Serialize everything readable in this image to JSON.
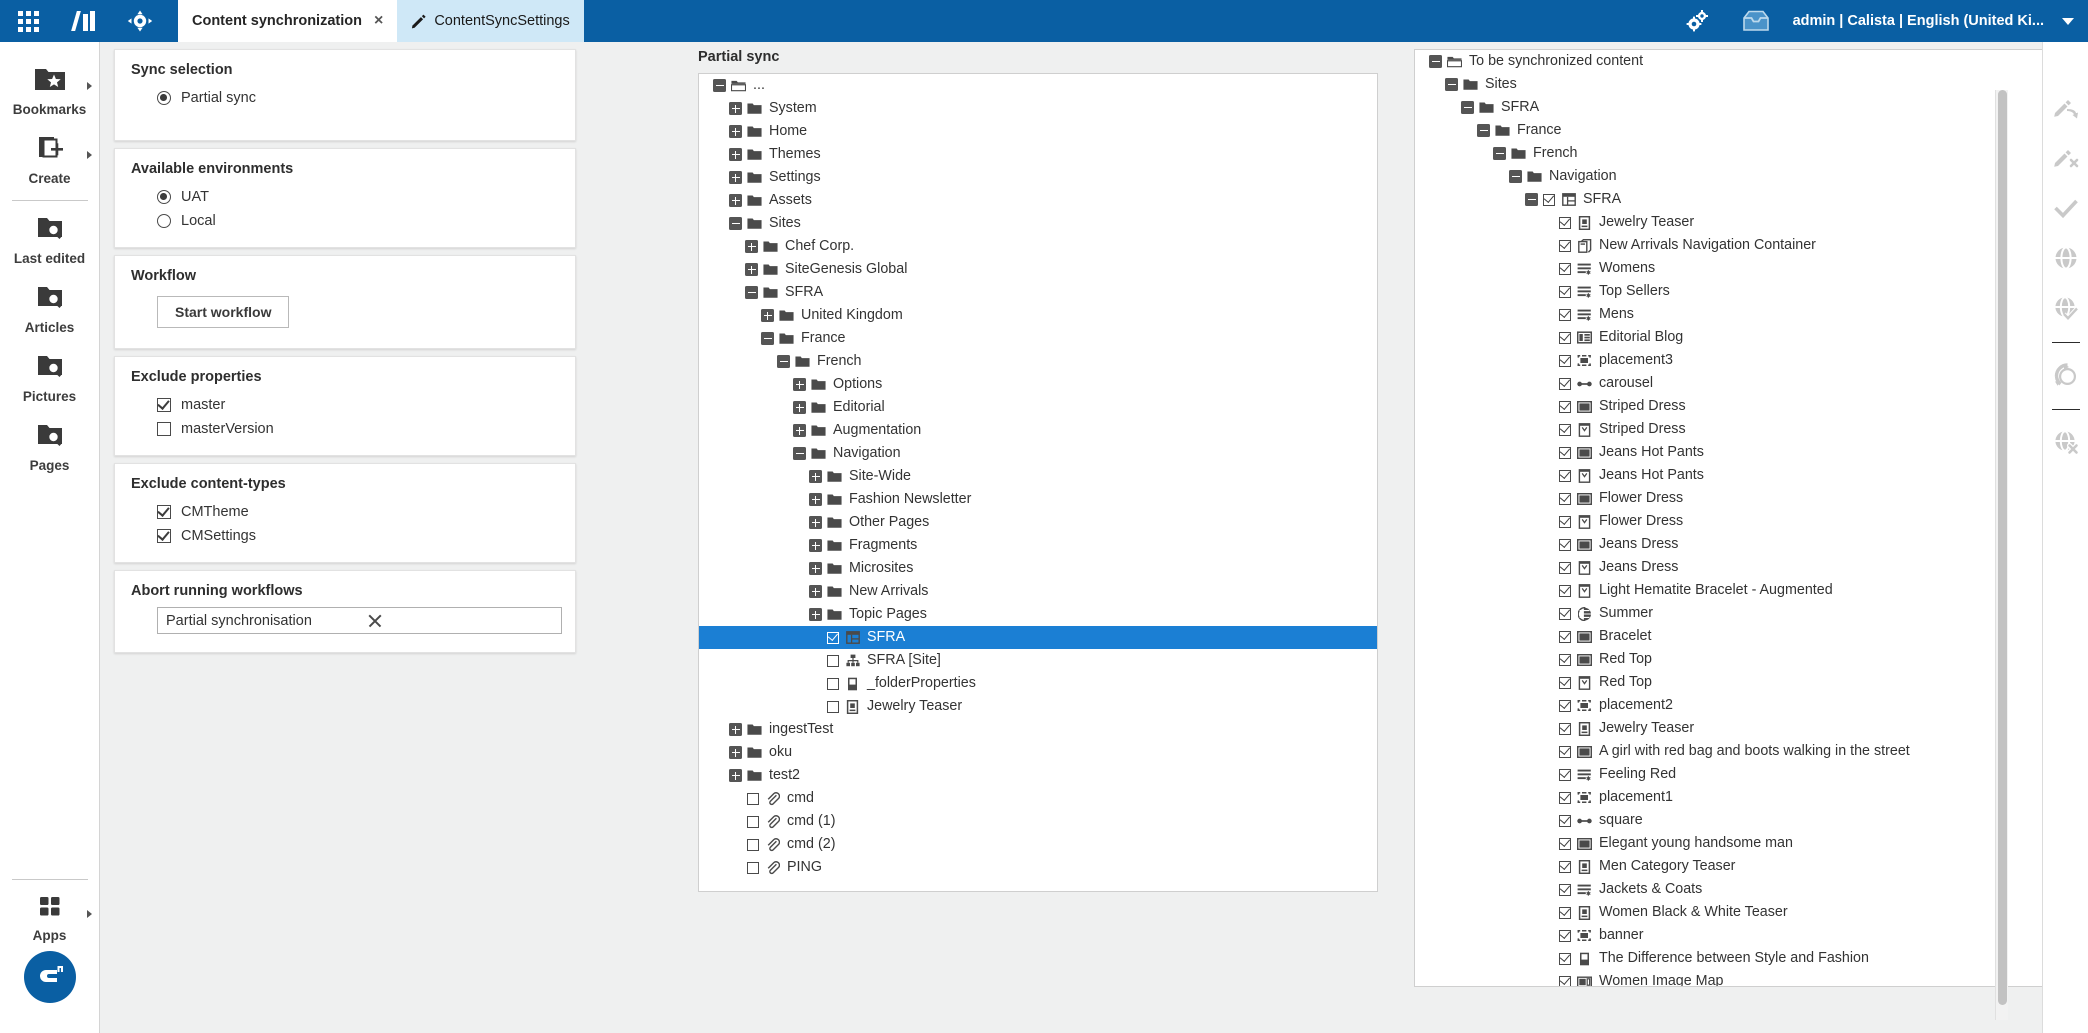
{
  "topbar": {
    "apps_grid_icon": "apps-grid-icon",
    "logo_icon": "coremedia-logo-icon",
    "compass_icon": "compass-icon",
    "tabs": [
      {
        "label": "Content synchronization",
        "active": true,
        "closable": true,
        "close_label": "×"
      },
      {
        "label": "ContentSyncSettings",
        "active": false,
        "icon": "pencil-icon"
      }
    ],
    "gears_icon": "gears-icon",
    "inbox_icon": "inbox-icon",
    "user": "admin | Calista | English (United Ki...",
    "caret_icon": "chevron-down-icon"
  },
  "leftrail": {
    "items": [
      {
        "label": "Bookmarks",
        "icon": "folder-star-icon",
        "arrow": true
      },
      {
        "label": "Create",
        "icon": "create-doc-icon",
        "arrow": true
      },
      {
        "label": "Last edited",
        "icon": "folder-search-icon",
        "arrow": false
      },
      {
        "label": "Articles",
        "icon": "folder-search-icon",
        "arrow": false
      },
      {
        "label": "Pictures",
        "icon": "folder-search-icon",
        "arrow": false
      },
      {
        "label": "Pages",
        "icon": "folder-search-icon",
        "arrow": false
      }
    ],
    "apps": {
      "label": "Apps",
      "icon": "apps-squares-icon",
      "arrow": true
    },
    "badge_icon": "coremedia-badge-icon"
  },
  "form": {
    "sync_selection": {
      "title": "Sync selection",
      "options": [
        {
          "label": "Partial sync",
          "checked": true
        }
      ]
    },
    "available_environments": {
      "title": "Available environments",
      "options": [
        {
          "label": "UAT",
          "checked": true
        },
        {
          "label": "Local",
          "checked": false
        }
      ]
    },
    "workflow": {
      "title": "Workflow",
      "button_label": "Start workflow"
    },
    "exclude_properties": {
      "title": "Exclude properties",
      "options": [
        {
          "label": "master",
          "checked": true
        },
        {
          "label": "masterVersion",
          "checked": false
        }
      ]
    },
    "exclude_content_types": {
      "title": "Exclude content-types",
      "options": [
        {
          "label": "CMTheme",
          "checked": true
        },
        {
          "label": "CMSettings",
          "checked": true
        }
      ]
    },
    "abort_running_workflows": {
      "title": "Abort running workflows",
      "value": "Partial synchronisation",
      "placeholder": "",
      "clear_icon": "clear-x-icon"
    }
  },
  "mid_panel": {
    "label": "Partial sync",
    "nodes": [
      {
        "depth": 0,
        "toggle": "minus",
        "icon": "folder-open-icon",
        "label": "..."
      },
      {
        "depth": 1,
        "toggle": "plus",
        "icon": "folder-icon",
        "label": "System"
      },
      {
        "depth": 1,
        "toggle": "plus",
        "icon": "folder-icon",
        "label": "Home"
      },
      {
        "depth": 1,
        "toggle": "plus",
        "icon": "folder-icon",
        "label": "Themes"
      },
      {
        "depth": 1,
        "toggle": "plus",
        "icon": "folder-icon",
        "label": "Settings"
      },
      {
        "depth": 1,
        "toggle": "plus",
        "icon": "folder-icon",
        "label": "Assets"
      },
      {
        "depth": 1,
        "toggle": "minus",
        "icon": "folder-icon",
        "label": "Sites"
      },
      {
        "depth": 2,
        "toggle": "plus",
        "icon": "folder-icon",
        "label": "Chef Corp."
      },
      {
        "depth": 2,
        "toggle": "plus",
        "icon": "folder-icon",
        "label": "SiteGenesis Global"
      },
      {
        "depth": 2,
        "toggle": "minus",
        "icon": "folder-icon",
        "label": "SFRA"
      },
      {
        "depth": 3,
        "toggle": "plus",
        "icon": "folder-icon",
        "label": "United Kingdom"
      },
      {
        "depth": 3,
        "toggle": "minus",
        "icon": "folder-icon",
        "label": "France"
      },
      {
        "depth": 4,
        "toggle": "minus",
        "icon": "folder-icon",
        "label": "French"
      },
      {
        "depth": 5,
        "toggle": "plus",
        "icon": "folder-icon",
        "label": "Options"
      },
      {
        "depth": 5,
        "toggle": "plus",
        "icon": "folder-icon",
        "label": "Editorial"
      },
      {
        "depth": 5,
        "toggle": "plus",
        "icon": "folder-icon",
        "label": "Augmentation"
      },
      {
        "depth": 5,
        "toggle": "minus",
        "icon": "folder-icon",
        "label": "Navigation"
      },
      {
        "depth": 6,
        "toggle": "plus",
        "icon": "folder-icon",
        "label": "Site-Wide"
      },
      {
        "depth": 6,
        "toggle": "plus",
        "icon": "folder-icon",
        "label": "Fashion Newsletter"
      },
      {
        "depth": 6,
        "toggle": "plus",
        "icon": "folder-icon",
        "label": "Other Pages"
      },
      {
        "depth": 6,
        "toggle": "plus",
        "icon": "folder-icon",
        "label": "Fragments"
      },
      {
        "depth": 6,
        "toggle": "plus",
        "icon": "folder-icon",
        "label": "Microsites"
      },
      {
        "depth": 6,
        "toggle": "plus",
        "icon": "folder-icon",
        "label": "New Arrivals"
      },
      {
        "depth": 6,
        "toggle": "plus",
        "icon": "folder-icon",
        "label": "Topic Pages"
      },
      {
        "depth": 6,
        "toggle": "none",
        "checkbox": true,
        "checked": true,
        "icon": "page-grid-icon",
        "label": "SFRA",
        "selected": true
      },
      {
        "depth": 6,
        "toggle": "none",
        "checkbox": true,
        "checked": false,
        "icon": "sitemap-icon",
        "label": "SFRA [Site]"
      },
      {
        "depth": 6,
        "toggle": "none",
        "checkbox": true,
        "checked": false,
        "icon": "properties-icon",
        "label": "_folderProperties"
      },
      {
        "depth": 6,
        "toggle": "none",
        "checkbox": true,
        "checked": false,
        "icon": "teaser-icon",
        "label": "Jewelry Teaser"
      },
      {
        "depth": 1,
        "toggle": "plus",
        "icon": "folder-icon",
        "label": "ingestTest"
      },
      {
        "depth": 1,
        "toggle": "plus",
        "icon": "folder-icon",
        "label": "oku"
      },
      {
        "depth": 1,
        "toggle": "plus",
        "icon": "folder-icon",
        "label": "test2"
      },
      {
        "depth": 1,
        "toggle": "none",
        "checkbox": true,
        "checked": false,
        "icon": "paperclip-icon",
        "label": "cmd"
      },
      {
        "depth": 1,
        "toggle": "none",
        "checkbox": true,
        "checked": false,
        "icon": "paperclip-icon",
        "label": "cmd (1)"
      },
      {
        "depth": 1,
        "toggle": "none",
        "checkbox": true,
        "checked": false,
        "icon": "paperclip-icon",
        "label": "cmd (2)"
      },
      {
        "depth": 1,
        "toggle": "none",
        "checkbox": true,
        "checked": false,
        "icon": "paperclip-icon",
        "label": "PING"
      }
    ]
  },
  "right_panel": {
    "nodes": [
      {
        "depth": 0,
        "toggle": "minus",
        "icon": "folder-open-icon",
        "label": "To be synchronized content"
      },
      {
        "depth": 1,
        "toggle": "minus",
        "icon": "folder-icon",
        "label": "Sites"
      },
      {
        "depth": 2,
        "toggle": "minus",
        "icon": "folder-icon",
        "label": "SFRA"
      },
      {
        "depth": 3,
        "toggle": "minus",
        "icon": "folder-icon",
        "label": "France"
      },
      {
        "depth": 4,
        "toggle": "minus",
        "icon": "folder-icon",
        "label": "French"
      },
      {
        "depth": 5,
        "toggle": "minus",
        "icon": "folder-icon",
        "label": "Navigation"
      },
      {
        "depth": 6,
        "toggle": "minus",
        "checkbox": true,
        "checked": true,
        "icon": "page-grid-icon",
        "label": "SFRA"
      },
      {
        "depth": 7,
        "toggle": "none",
        "checkbox": true,
        "checked": true,
        "icon": "teaser-icon",
        "label": "Jewelry Teaser"
      },
      {
        "depth": 7,
        "toggle": "none",
        "checkbox": true,
        "checked": true,
        "icon": "container-icon",
        "label": "New Arrivals Navigation Container"
      },
      {
        "depth": 7,
        "toggle": "none",
        "checkbox": true,
        "checked": true,
        "icon": "collection-icon",
        "label": "Womens"
      },
      {
        "depth": 7,
        "toggle": "none",
        "checkbox": true,
        "checked": true,
        "icon": "collection-icon",
        "label": "Top Sellers"
      },
      {
        "depth": 7,
        "toggle": "none",
        "checkbox": true,
        "checked": true,
        "icon": "collection-icon",
        "label": "Mens"
      },
      {
        "depth": 7,
        "toggle": "none",
        "checkbox": true,
        "checked": true,
        "icon": "article-icon",
        "label": "Editorial Blog"
      },
      {
        "depth": 7,
        "toggle": "none",
        "checkbox": true,
        "checked": true,
        "icon": "placement-icon",
        "label": "placement3"
      },
      {
        "depth": 7,
        "toggle": "none",
        "checkbox": true,
        "checked": true,
        "icon": "carousel-icon",
        "label": "carousel"
      },
      {
        "depth": 7,
        "toggle": "none",
        "checkbox": true,
        "checked": true,
        "icon": "picture-icon",
        "label": "Striped Dress"
      },
      {
        "depth": 7,
        "toggle": "none",
        "checkbox": true,
        "checked": true,
        "icon": "product-teaser-icon",
        "label": "Striped Dress"
      },
      {
        "depth": 7,
        "toggle": "none",
        "checkbox": true,
        "checked": true,
        "icon": "picture-icon",
        "label": "Jeans Hot Pants"
      },
      {
        "depth": 7,
        "toggle": "none",
        "checkbox": true,
        "checked": true,
        "icon": "product-teaser-icon",
        "label": "Jeans Hot Pants"
      },
      {
        "depth": 7,
        "toggle": "none",
        "checkbox": true,
        "checked": true,
        "icon": "picture-icon",
        "label": "Flower Dress"
      },
      {
        "depth": 7,
        "toggle": "none",
        "checkbox": true,
        "checked": true,
        "icon": "product-teaser-icon",
        "label": "Flower Dress"
      },
      {
        "depth": 7,
        "toggle": "none",
        "checkbox": true,
        "checked": true,
        "icon": "picture-icon",
        "label": "Jeans Dress"
      },
      {
        "depth": 7,
        "toggle": "none",
        "checkbox": true,
        "checked": true,
        "icon": "product-teaser-icon",
        "label": "Jeans Dress"
      },
      {
        "depth": 7,
        "toggle": "none",
        "checkbox": true,
        "checked": true,
        "icon": "product-teaser-icon",
        "label": "Light Hematite Bracelet - Augmented"
      },
      {
        "depth": 7,
        "toggle": "none",
        "checkbox": true,
        "checked": true,
        "icon": "tag-icon",
        "label": "Summer"
      },
      {
        "depth": 7,
        "toggle": "none",
        "checkbox": true,
        "checked": true,
        "icon": "picture-icon",
        "label": "Bracelet"
      },
      {
        "depth": 7,
        "toggle": "none",
        "checkbox": true,
        "checked": true,
        "icon": "picture-icon",
        "label": "Red Top"
      },
      {
        "depth": 7,
        "toggle": "none",
        "checkbox": true,
        "checked": true,
        "icon": "product-teaser-icon",
        "label": "Red Top"
      },
      {
        "depth": 7,
        "toggle": "none",
        "checkbox": true,
        "checked": true,
        "icon": "placement-icon",
        "label": "placement2"
      },
      {
        "depth": 7,
        "toggle": "none",
        "checkbox": true,
        "checked": true,
        "icon": "teaser-icon",
        "label": "Jewelry Teaser"
      },
      {
        "depth": 7,
        "toggle": "none",
        "checkbox": true,
        "checked": true,
        "icon": "picture-icon",
        "label": "A girl with red bag and boots walking in the street"
      },
      {
        "depth": 7,
        "toggle": "none",
        "checkbox": true,
        "checked": true,
        "icon": "collection-icon",
        "label": "Feeling Red"
      },
      {
        "depth": 7,
        "toggle": "none",
        "checkbox": true,
        "checked": true,
        "icon": "placement-icon",
        "label": "placement1"
      },
      {
        "depth": 7,
        "toggle": "none",
        "checkbox": true,
        "checked": true,
        "icon": "carousel-icon",
        "label": "square"
      },
      {
        "depth": 7,
        "toggle": "none",
        "checkbox": true,
        "checked": true,
        "icon": "picture-icon",
        "label": "Elegant young handsome man"
      },
      {
        "depth": 7,
        "toggle": "none",
        "checkbox": true,
        "checked": true,
        "icon": "teaser-icon",
        "label": "Men Category Teaser"
      },
      {
        "depth": 7,
        "toggle": "none",
        "checkbox": true,
        "checked": true,
        "icon": "collection-icon",
        "label": "Jackets & Coats"
      },
      {
        "depth": 7,
        "toggle": "none",
        "checkbox": true,
        "checked": true,
        "icon": "teaser-icon",
        "label": "Women Black & White Teaser"
      },
      {
        "depth": 7,
        "toggle": "none",
        "checkbox": true,
        "checked": true,
        "icon": "placement-icon",
        "label": "banner"
      },
      {
        "depth": 7,
        "toggle": "none",
        "checkbox": true,
        "checked": true,
        "icon": "properties-icon",
        "label": "The Difference between Style and Fashion"
      },
      {
        "depth": 7,
        "toggle": "none",
        "checkbox": true,
        "checked": true,
        "icon": "imagemap-icon",
        "label": "Women Image Map"
      }
    ]
  },
  "iconbar": {
    "items": [
      {
        "icon": "check-out-icon"
      },
      {
        "icon": "check-in-cancel-icon"
      },
      {
        "icon": "approve-check-icon"
      },
      {
        "icon": "publish-globe-icon"
      },
      {
        "icon": "publish-approved-globe-icon"
      },
      {
        "sep": true
      },
      {
        "icon": "republish-globe-icon"
      },
      {
        "sep": true
      },
      {
        "icon": "withdraw-globe-icon"
      }
    ]
  },
  "colors": {
    "brand_blue": "#0a5fa3",
    "selection_blue": "#1b7fd4",
    "tab_secondary": "#cfe8f7",
    "content_bg": "#eff0f0"
  }
}
